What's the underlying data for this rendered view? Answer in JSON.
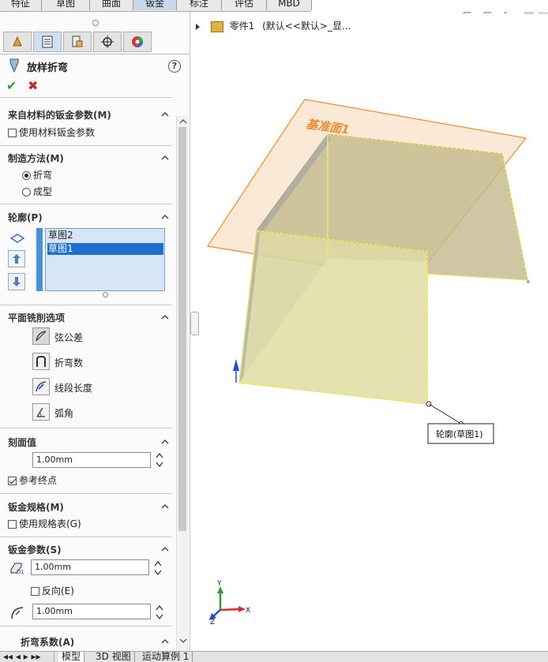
{
  "command_tabs": [
    "特征",
    "草图",
    "曲面",
    "钣金",
    "标注",
    "评估",
    "MBD"
  ],
  "active_tab": "钣金",
  "feature_tree": {
    "part_name": "零件1",
    "config_text": "(默认<<默认>_显..."
  },
  "property_manager": {
    "title": "放样折弯",
    "help_icon": "?",
    "sections": {
      "material_params": {
        "title": "来自材料的钣金参数(M)",
        "checkbox_label": "使用材料钣金参数",
        "checked": false
      },
      "method": {
        "title": "制造方法(M)",
        "options": [
          "折弯",
          "成型"
        ],
        "selected": "折弯"
      },
      "profiles": {
        "title": "轮廓(P)",
        "items": [
          "草图2",
          "草图1"
        ],
        "selected": "草图1"
      },
      "faceted": {
        "title": "平面铣削选项",
        "options": [
          "弦公差",
          "折弯数",
          "线段长度",
          "弧角"
        ],
        "selected": "弦公差"
      },
      "facet_value": {
        "title": "刻面值",
        "value": "1.00mm",
        "ref_endpoint_label": "参考终点",
        "ref_endpoint_checked": true
      },
      "gauge": {
        "title": "钣金规格(M)",
        "checkbox_label": "使用规格表(G)",
        "checked": false
      },
      "sheet_params": {
        "title": "钣金参数(S)",
        "thickness": "1.00mm",
        "reverse_label": "反向(E)",
        "reverse_checked": false,
        "radius": "1.00mm"
      },
      "bend_allowance": {
        "title": "折弯系数(A)"
      }
    }
  },
  "viewport": {
    "plane_label": "基准面1",
    "callout_label": "轮廓(草图1)",
    "triad": {
      "x": "X",
      "y": "Y",
      "z": "Z"
    }
  },
  "bottom_tabs": [
    "模型",
    "3D 视图",
    "运动算例 1"
  ],
  "active_bottom_tab": "模型",
  "colors": {
    "plane": "#f08a2a",
    "part_fill": "#d8d59a",
    "selection": "#1e6fd0",
    "accept": "#2f9a2f",
    "cancel": "#c62828"
  }
}
